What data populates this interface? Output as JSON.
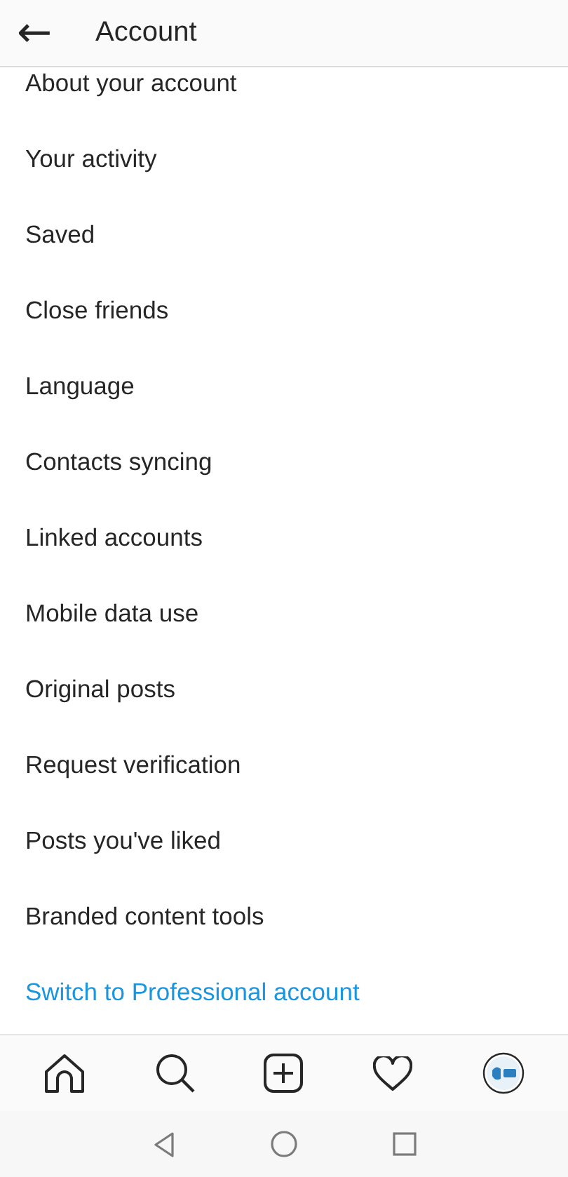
{
  "header": {
    "back_icon": "←",
    "title": "Account"
  },
  "menu_items": [
    {
      "label": "About your account",
      "kind": "plain"
    },
    {
      "label": "Your activity",
      "kind": "plain"
    },
    {
      "label": "Saved",
      "kind": "plain"
    },
    {
      "label": "Close friends",
      "kind": "plain"
    },
    {
      "label": "Language",
      "kind": "plain"
    },
    {
      "label": "Contacts syncing",
      "kind": "plain"
    },
    {
      "label": "Linked accounts",
      "kind": "plain"
    },
    {
      "label": "Mobile data use",
      "kind": "plain"
    },
    {
      "label": "Original posts",
      "kind": "plain"
    },
    {
      "label": "Request verification",
      "kind": "plain"
    },
    {
      "label": "Posts you've liked",
      "kind": "plain"
    },
    {
      "label": "Branded content tools",
      "kind": "plain"
    },
    {
      "label": "Switch to Professional account",
      "kind": "link"
    }
  ]
}
